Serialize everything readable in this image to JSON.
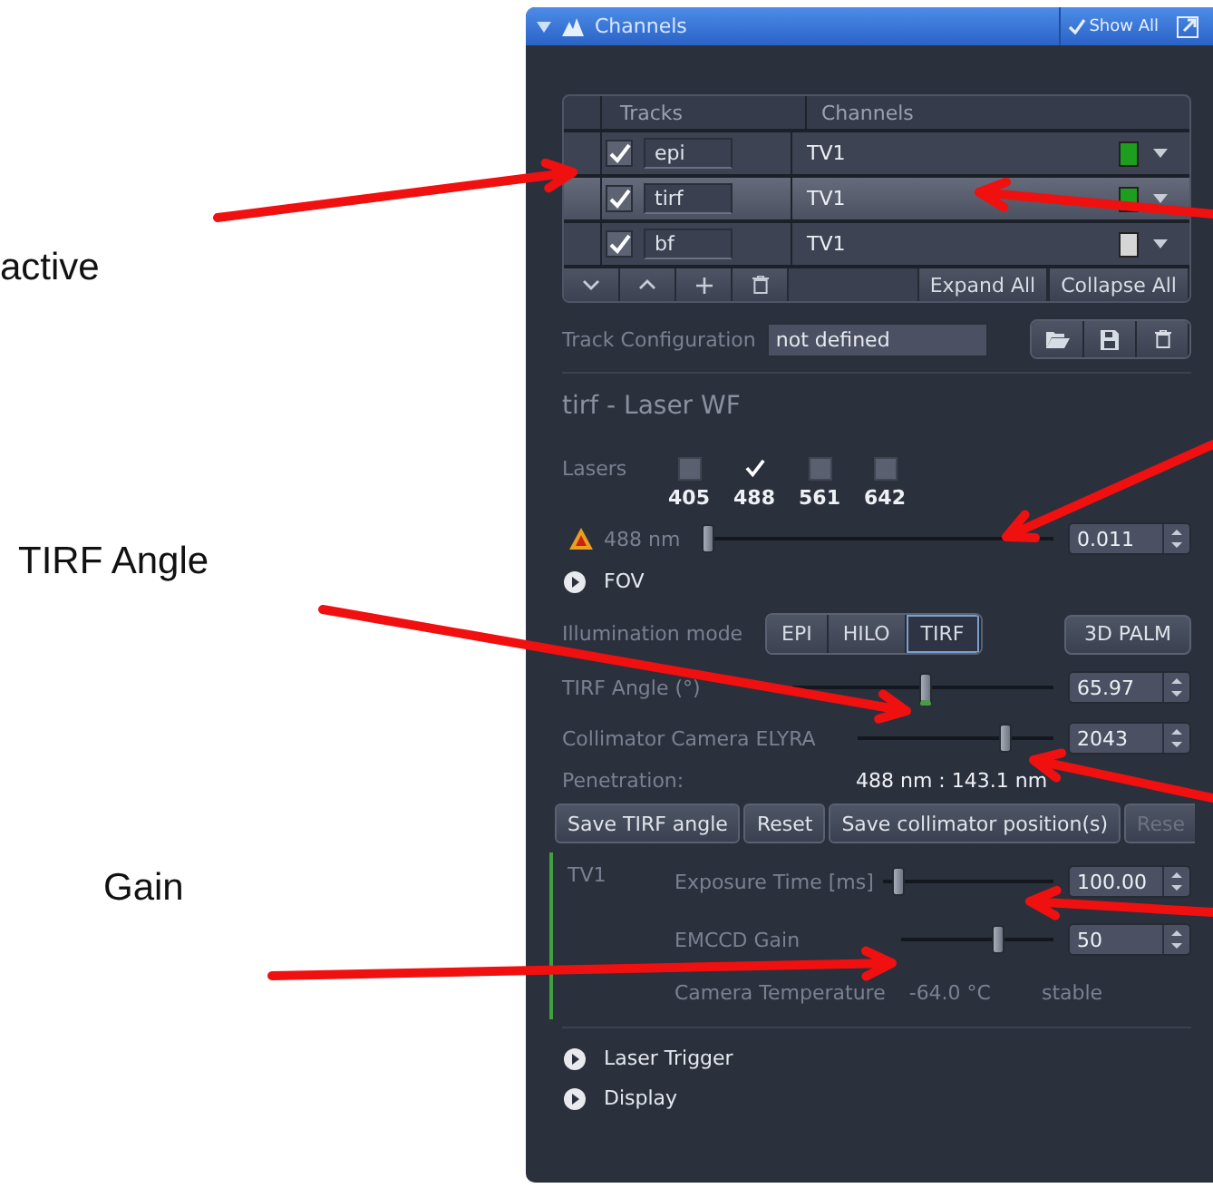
{
  "annotations": [
    {
      "text": "active"
    },
    {
      "text": "TIRF Angle"
    },
    {
      "text": "Gain"
    }
  ],
  "panel": {
    "title": "Channels",
    "show_all": "Show All",
    "tracks_table": {
      "columns": [
        "Tracks",
        "Channels"
      ],
      "rows": [
        {
          "track": "epi",
          "checked": true,
          "channel": "TV1",
          "color": "#1e9e1e",
          "selected": false
        },
        {
          "track": "tirf",
          "checked": true,
          "channel": "TV1",
          "color": "#1e9e1e",
          "selected": true
        },
        {
          "track": "bf",
          "checked": true,
          "channel": "TV1",
          "color": "#d6d6d6",
          "selected": false
        }
      ],
      "actions": [
        "Expand All",
        "Collapse All"
      ]
    },
    "track_configuration": {
      "label": "Track Configuration",
      "value": "not defined"
    },
    "section_title": "tirf - Laser WF",
    "lasers": {
      "label": "Lasers",
      "items": [
        {
          "label": "405",
          "checked": false
        },
        {
          "label": "488",
          "checked": true
        },
        {
          "label": "561",
          "checked": false
        },
        {
          "label": "642",
          "checked": false
        }
      ]
    },
    "laser_power": {
      "label": "488 nm",
      "level": 0.0,
      "value": "0.011"
    },
    "fov": "FOV",
    "illumination": {
      "label": "Illumination mode",
      "modes": [
        {
          "label": "EPI",
          "selected": false
        },
        {
          "label": "HILO",
          "selected": false
        },
        {
          "label": "TIRF",
          "selected": true
        }
      ],
      "extra_button": "3D PALM"
    },
    "sliders": [
      {
        "label": "TIRF Angle (°)",
        "level": 0.5,
        "value": "65.97"
      },
      {
        "label": "Collimator Camera ELYRA",
        "level": 0.74,
        "value": "2043"
      }
    ],
    "penetration": {
      "label": "Penetration:",
      "value": "488 nm : 143.1 nm"
    },
    "buttons": [
      {
        "label": "Save TIRF angle",
        "disabled": false
      },
      {
        "label": "Reset",
        "disabled": false
      },
      {
        "label": "Save collimator position(s)",
        "disabled": false
      },
      {
        "label": "Rese",
        "disabled": true
      }
    ],
    "camera": {
      "channel": "TV1",
      "sliders": [
        {
          "label": "Exposure Time [ms]",
          "level": 0.07,
          "value": "100.00"
        },
        {
          "label": "EMCCD Gain",
          "level": 0.62,
          "value": "50"
        }
      ],
      "temperature": {
        "label": "Camera Temperature",
        "value": "-64.0 °C",
        "status": "stable"
      }
    },
    "sections": [
      "Laser Trigger",
      "Display"
    ]
  }
}
